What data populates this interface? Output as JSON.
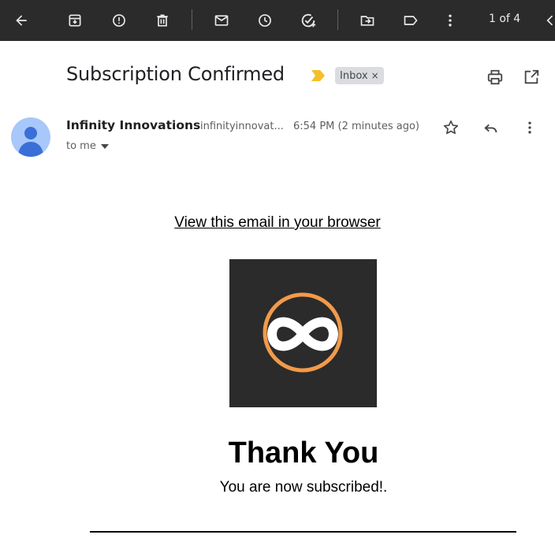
{
  "toolbar": {
    "buttons": [
      "back-icon",
      "archive-icon",
      "report-spam-icon",
      "delete-icon",
      "mark-unread-icon",
      "snooze-icon",
      "add-task-icon",
      "move-to-icon",
      "label-icon",
      "more-icon",
      "newer-icon"
    ],
    "pager": "1 of 4"
  },
  "email": {
    "subject": "Subscription Confirmed",
    "label_chip": "Inbox",
    "label_chip_close": "×",
    "sender": {
      "name": "Infinity Innovations",
      "email": "infinityinnovat...",
      "timestamp": "6:54 PM (2 minutes ago)",
      "recipient": "to me"
    },
    "body": {
      "view_in_browser": "View this email in your browser",
      "heading": "Thank You",
      "message": "You are now subscribed!."
    }
  },
  "colors": {
    "toolbar_bg": "#2b2b2b",
    "importance_marker": "#f6bf26",
    "logo_bg": "#2b2b2b",
    "logo_ring": "#f29a4a",
    "avatar_bg": "#a8c7fa",
    "avatar_figure": "#3a6fd8"
  }
}
